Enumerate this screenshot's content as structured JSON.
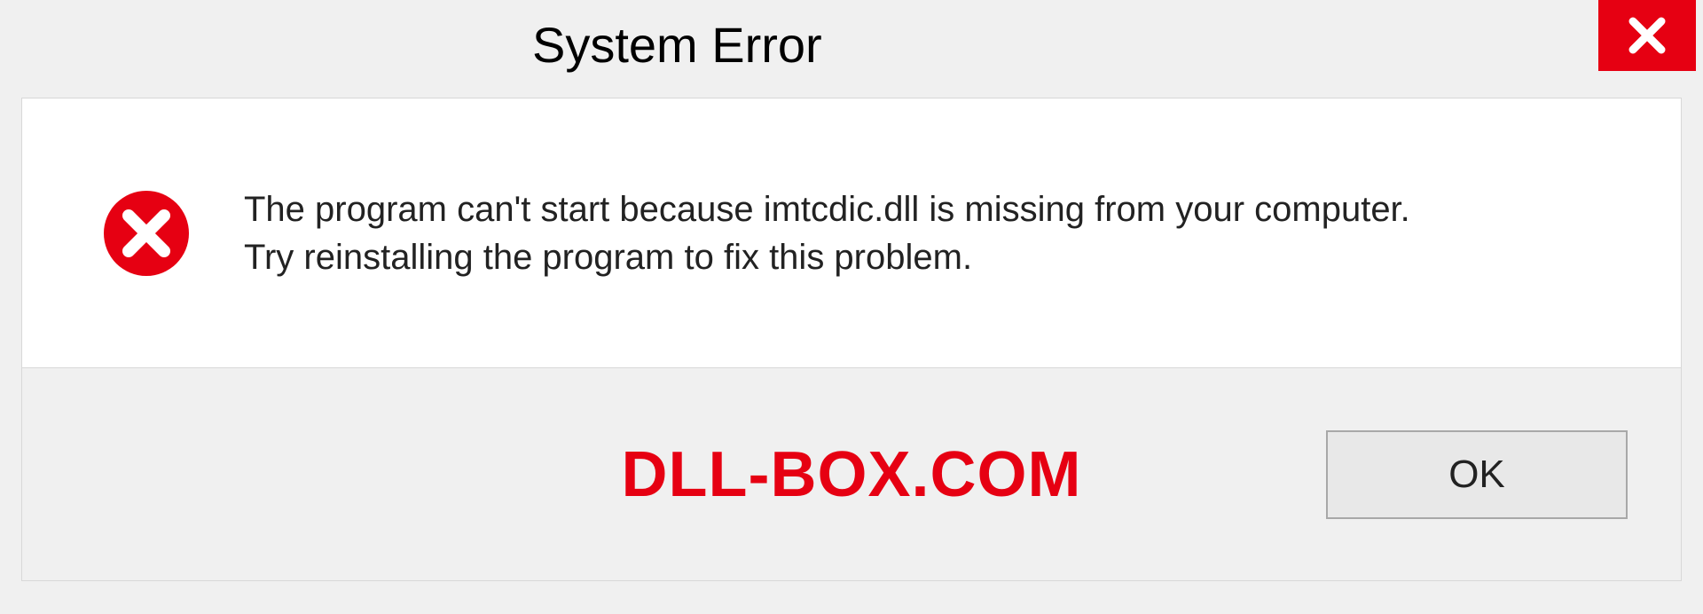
{
  "dialog": {
    "title": "System Error",
    "message_line1": "The program can't start because imtcdic.dll is missing from your computer.",
    "message_line2": "Try reinstalling the program to fix this problem.",
    "ok_label": "OK"
  },
  "watermark": "DLL-BOX.COM"
}
